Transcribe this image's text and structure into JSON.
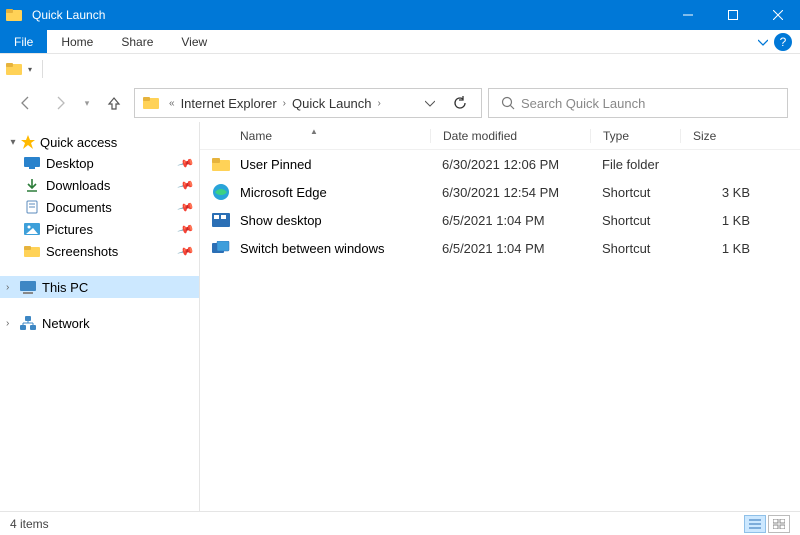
{
  "window": {
    "title": "Quick Launch"
  },
  "ribbon": {
    "file": "File",
    "home": "Home",
    "share": "Share",
    "view": "View"
  },
  "breadcrumb": {
    "part1": "Internet Explorer",
    "part2": "Quick Launch"
  },
  "search": {
    "placeholder": "Search Quick Launch"
  },
  "sidebar": {
    "quick_access": "Quick access",
    "desktop": "Desktop",
    "downloads": "Downloads",
    "documents": "Documents",
    "pictures": "Pictures",
    "screenshots": "Screenshots",
    "this_pc": "This PC",
    "network": "Network"
  },
  "columns": {
    "name": "Name",
    "date": "Date modified",
    "type": "Type",
    "size": "Size"
  },
  "rows": [
    {
      "name": "User Pinned",
      "date": "6/30/2021 12:06 PM",
      "type": "File folder",
      "size": ""
    },
    {
      "name": "Microsoft Edge",
      "date": "6/30/2021 12:54 PM",
      "type": "Shortcut",
      "size": "3 KB"
    },
    {
      "name": "Show desktop",
      "date": "6/5/2021 1:04 PM",
      "type": "Shortcut",
      "size": "1 KB"
    },
    {
      "name": "Switch between windows",
      "date": "6/5/2021 1:04 PM",
      "type": "Shortcut",
      "size": "1 KB"
    }
  ],
  "status": {
    "count": "4 items"
  }
}
